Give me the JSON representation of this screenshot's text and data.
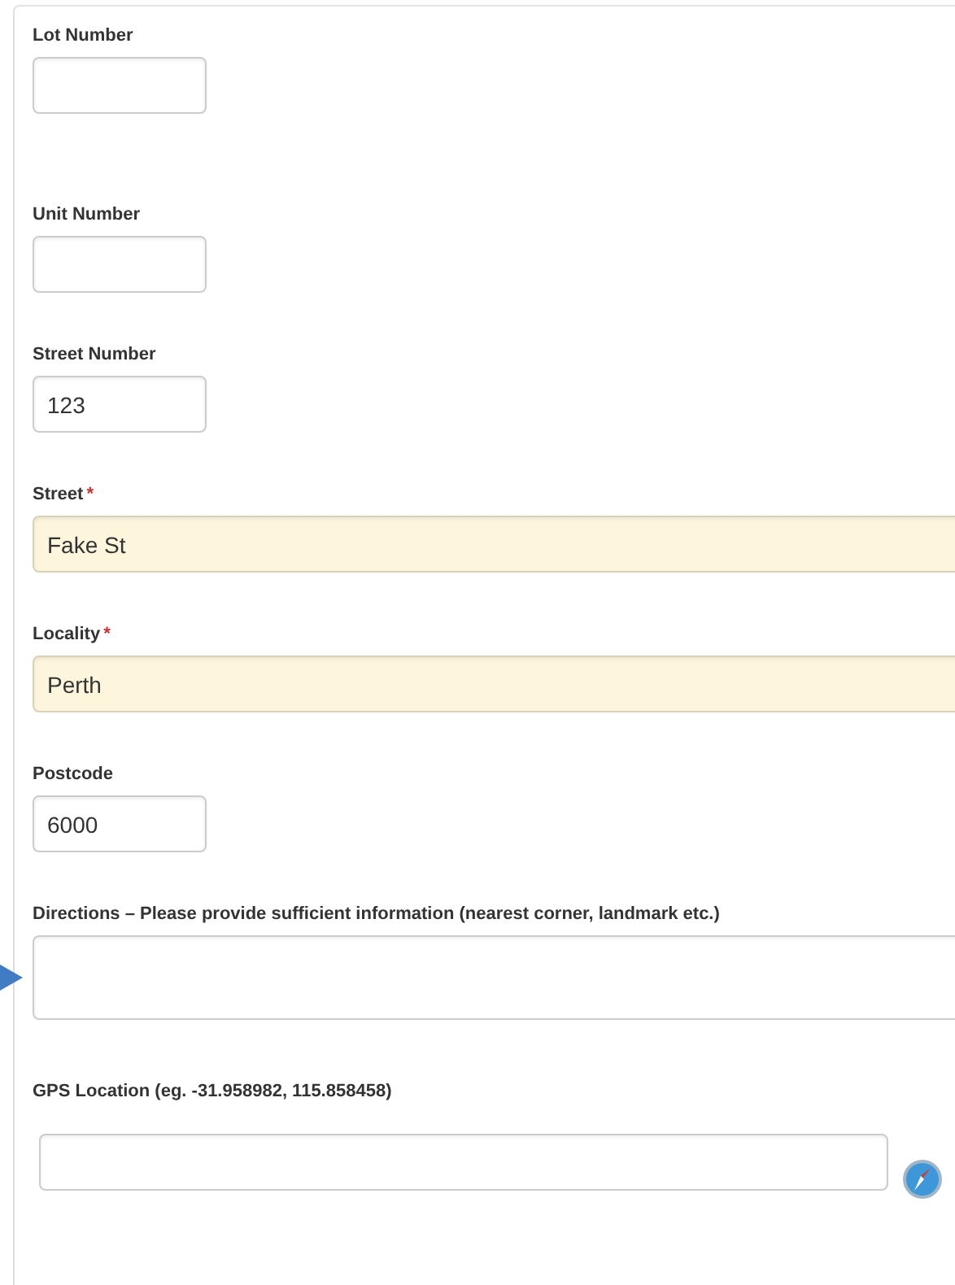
{
  "fields": [
    {
      "kind": "short",
      "label": "Lot Number",
      "required": false
    },
    {
      "kind": "short",
      "label": "Unit Number",
      "required": false
    },
    {
      "kind": "short",
      "label": "Street Number",
      "required": false,
      "value": "123"
    },
    {
      "kind": "wide",
      "label": "Street",
      "required": true,
      "required_mark": "*",
      "value": "Fake St"
    },
    {
      "kind": "wide",
      "label": "Locality",
      "required": true,
      "required_mark": "*",
      "value": "Perth"
    },
    {
      "kind": "short",
      "label": "Postcode",
      "required": false,
      "value": "6000"
    },
    {
      "kind": "textarea",
      "label": "Directions – Please provide sufficient information (nearest corner, landmark etc.)",
      "required": false
    },
    {
      "kind": "gps",
      "label": "GPS Location (eg. -31.958982, 115.858458)",
      "required": false
    }
  ]
}
